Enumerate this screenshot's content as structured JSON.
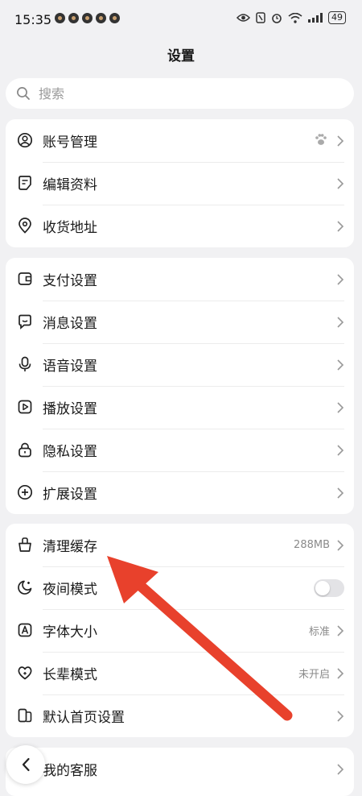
{
  "status_bar": {
    "time": "15:35",
    "battery": "49"
  },
  "header": {
    "title": "设置"
  },
  "search": {
    "placeholder": "搜索"
  },
  "group1": [
    {
      "label": "账号管理",
      "icon": "user-circle-icon",
      "badge": "paw-icon"
    },
    {
      "label": "编辑资料",
      "icon": "edit-note-icon"
    },
    {
      "label": "收货地址",
      "icon": "location-pin-icon"
    }
  ],
  "group2": [
    {
      "label": "支付设置",
      "icon": "wallet-icon"
    },
    {
      "label": "消息设置",
      "icon": "chat-bubble-icon"
    },
    {
      "label": "语音设置",
      "icon": "microphone-icon"
    },
    {
      "label": "播放设置",
      "icon": "play-icon"
    },
    {
      "label": "隐私设置",
      "icon": "lock-icon"
    },
    {
      "label": "扩展设置",
      "icon": "plus-circle-icon"
    }
  ],
  "group3": [
    {
      "label": "清理缓存",
      "value": "288MB",
      "icon": "broom-icon"
    },
    {
      "label": "夜间模式",
      "toggle": false,
      "icon": "moon-icon"
    },
    {
      "label": "字体大小",
      "value": "标准",
      "icon": "font-a-icon"
    },
    {
      "label": "长辈模式",
      "value": "未开启",
      "icon": "heart-icon"
    },
    {
      "label": "默认首页设置",
      "icon": "home-page-icon"
    }
  ],
  "group4": [
    {
      "label": "我的客服",
      "icon": "headset-icon"
    }
  ],
  "colors": {
    "background": "#f1f1f3",
    "card": "#ffffff",
    "annotation_arrow": "#e8412c"
  }
}
